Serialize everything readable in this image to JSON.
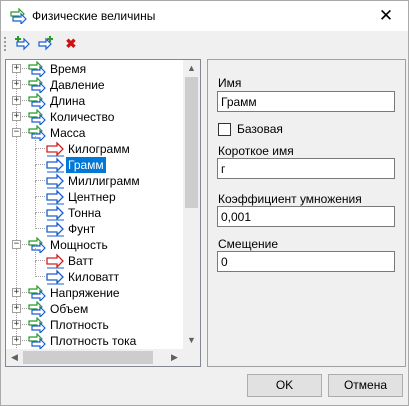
{
  "window": {
    "title": "Физические величины",
    "close_label": "✕"
  },
  "toolbar": {
    "add_label": "Add",
    "add_child_label": "Add child",
    "delete_label": "✖"
  },
  "tree": {
    "items": [
      {
        "label": "Время",
        "level": 0,
        "expander": "+",
        "icon": "group-icon"
      },
      {
        "label": "Давление",
        "level": 0,
        "expander": "+",
        "icon": "group-icon"
      },
      {
        "label": "Длина",
        "level": 0,
        "expander": "+",
        "icon": "group-icon"
      },
      {
        "label": "Количество",
        "level": 0,
        "expander": "+",
        "icon": "group-icon"
      },
      {
        "label": "Масса",
        "level": 0,
        "expander": "−",
        "icon": "group-icon"
      },
      {
        "label": "Килограмм",
        "level": 1,
        "icon": "base-unit-icon"
      },
      {
        "label": "Грамм",
        "level": 1,
        "icon": "unit-icon",
        "selected": true
      },
      {
        "label": "Миллиграмм",
        "level": 1,
        "icon": "unit-icon"
      },
      {
        "label": "Центнер",
        "level": 1,
        "icon": "unit-icon"
      },
      {
        "label": "Тонна",
        "level": 1,
        "icon": "unit-icon"
      },
      {
        "label": "Фунт",
        "level": 1,
        "icon": "unit-icon"
      },
      {
        "label": "Мощность",
        "level": 0,
        "expander": "−",
        "icon": "group-icon"
      },
      {
        "label": "Ватт",
        "level": 1,
        "icon": "base-unit-icon"
      },
      {
        "label": "Киловатт",
        "level": 1,
        "icon": "unit-icon"
      },
      {
        "label": "Напряжение",
        "level": 0,
        "expander": "+",
        "icon": "group-icon"
      },
      {
        "label": "Объем",
        "level": 0,
        "expander": "+",
        "icon": "group-icon"
      },
      {
        "label": "Плотность",
        "level": 0,
        "expander": "+",
        "icon": "group-icon"
      },
      {
        "label": "Плотность тока",
        "level": 0,
        "expander": "+",
        "icon": "group-icon"
      }
    ]
  },
  "props": {
    "name_label": "Имя",
    "name_value": "Грамм",
    "base_label": "Базовая",
    "base_checked": false,
    "short_label": "Короткое имя",
    "short_value": "г",
    "factor_label": "Коэффициент умножения",
    "factor_value": "0,001",
    "offset_label": "Смещение",
    "offset_value": "0"
  },
  "buttons": {
    "ok": "OK",
    "cancel": "Отмена"
  },
  "colors": {
    "selection": "#0078d7",
    "arrow_blue": "#1a5fd0",
    "arrow_red": "#d02020",
    "arrow_green": "#2a9a2a"
  }
}
